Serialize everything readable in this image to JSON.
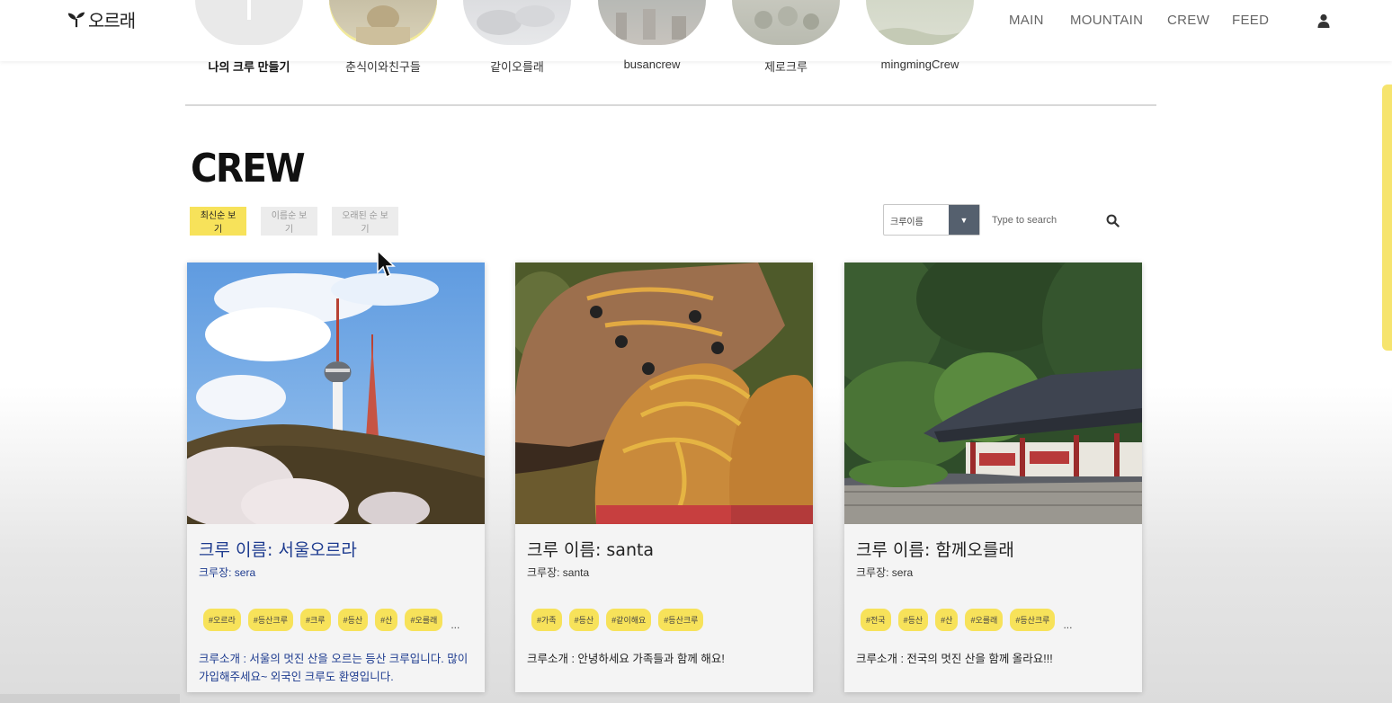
{
  "header": {
    "logo_text": "오르래",
    "nav": [
      "MAIN",
      "MOUNTAIN",
      "CREW",
      "FEED"
    ],
    "user_icon": "user-icon"
  },
  "crew_strip": [
    {
      "label": "나의 크루 만들기",
      "bold": true
    },
    {
      "label": "춘식이와친구들",
      "bold": false
    },
    {
      "label": "같이오를래",
      "bold": false
    },
    {
      "label": "busancrew",
      "bold": false
    },
    {
      "label": "제로크루",
      "bold": false
    },
    {
      "label": "mingmingCrew",
      "bold": false
    }
  ],
  "section": {
    "title": "CREW",
    "sort_buttons": [
      "최신순 보기",
      "이름순 보기",
      "오래된 순 보기"
    ],
    "search": {
      "select_value": "크루이름",
      "placeholder": "Type to search"
    }
  },
  "cards": [
    {
      "title": "크루 이름: 서울오르라",
      "leader": "크루장: sera",
      "tags": [
        "#오르라",
        "#등산크루",
        "#크루",
        "#등산",
        "#산",
        "#오를래"
      ],
      "more": "...",
      "desc": "크루소개 : 서울의 멋진 산을 오르는 등산 크루입니다. 많이 가입해주세요~ 외국인 크루도 환영입니다."
    },
    {
      "title": "크루 이름: santa",
      "leader": "크루장: santa",
      "tags": [
        "#가족",
        "#등산",
        "#같이해요",
        "#등산크루"
      ],
      "more": "",
      "desc": "크루소개 : 안녕하세요 가족들과 함께 해요!"
    },
    {
      "title": "크루 이름: 함께오를래",
      "leader": "크루장: sera",
      "tags": [
        "#전국",
        "#등산",
        "#산",
        "#오를래",
        "#등산크루"
      ],
      "more": "...",
      "desc": "크루소개 : 전국의 멋진 산을 함께 올라요!!!"
    }
  ],
  "colors": {
    "accent": "#f7e25a",
    "link_blue": "#1d3b8f",
    "select_dark": "#55606e"
  }
}
